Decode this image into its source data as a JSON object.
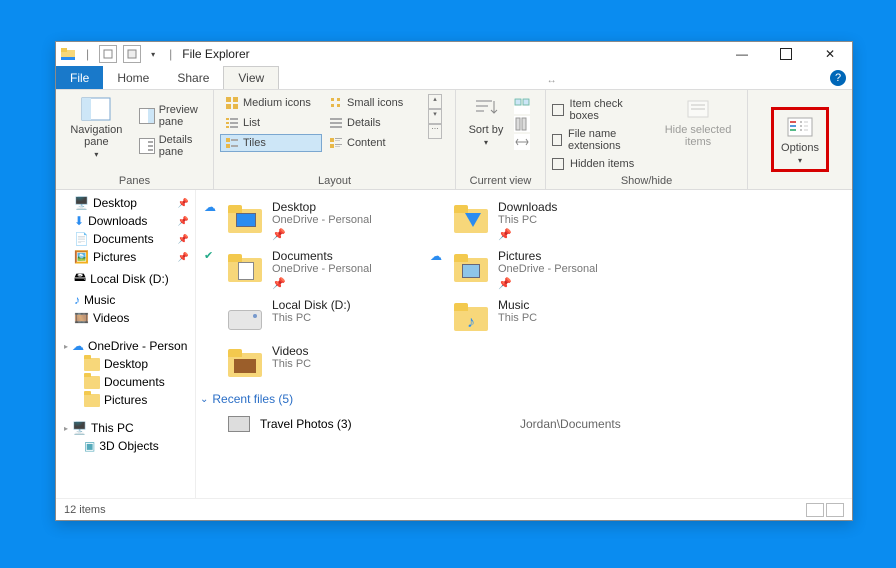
{
  "window": {
    "title": "File Explorer"
  },
  "tabs": {
    "file": "File",
    "home": "Home",
    "share": "Share",
    "view": "View"
  },
  "ribbon": {
    "panes": {
      "label": "Panes",
      "navigation": "Navigation pane",
      "preview": "Preview pane",
      "details": "Details pane"
    },
    "layout": {
      "label": "Layout",
      "medium": "Medium icons",
      "small": "Small icons",
      "list": "List",
      "details": "Details",
      "tiles": "Tiles",
      "content": "Content"
    },
    "currentview": {
      "label": "Current view",
      "sortby": "Sort by"
    },
    "showhide": {
      "label": "Show/hide",
      "itemcheck": "Item check boxes",
      "extensions": "File name extensions",
      "hidden": "Hidden items",
      "hidesel": "Hide selected items"
    },
    "options": "Options"
  },
  "nav": {
    "desktop": "Desktop",
    "downloads": "Downloads",
    "documents": "Documents",
    "pictures": "Pictures",
    "localdisk": "Local Disk (D:)",
    "music": "Music",
    "videos": "Videos",
    "onedrive": "OneDrive - Person",
    "od_desktop": "Desktop",
    "od_documents": "Documents",
    "od_pictures": "Pictures",
    "thispc": "This PC",
    "d3": "3D Objects"
  },
  "items": {
    "desktop": {
      "name": "Desktop",
      "sub": "OneDrive - Personal"
    },
    "downloads": {
      "name": "Downloads",
      "sub": "This PC"
    },
    "documents": {
      "name": "Documents",
      "sub": "OneDrive - Personal"
    },
    "pictures": {
      "name": "Pictures",
      "sub": "OneDrive - Personal"
    },
    "localdisk": {
      "name": "Local Disk (D:)",
      "sub": "This PC"
    },
    "music": {
      "name": "Music",
      "sub": "This PC"
    },
    "videos": {
      "name": "Videos",
      "sub": "This PC"
    }
  },
  "recent": {
    "header": "Recent files (5)",
    "item_name": "Travel Photos (3)",
    "item_loc": "Jordan\\Documents"
  },
  "status": {
    "count": "12 items"
  }
}
